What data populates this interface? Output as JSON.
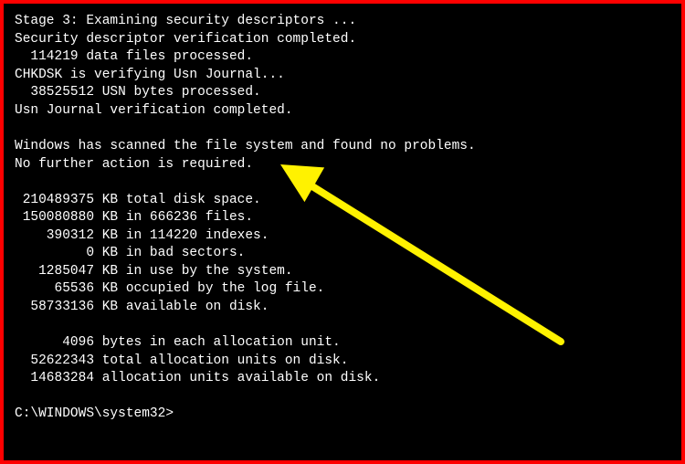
{
  "lines": [
    "Stage 3: Examining security descriptors ...",
    "Security descriptor verification completed.",
    "  114219 data files processed.",
    "CHKDSK is verifying Usn Journal...",
    "  38525512 USN bytes processed.",
    "Usn Journal verification completed.",
    "",
    "Windows has scanned the file system and found no problems.",
    "No further action is required.",
    "",
    " 210489375 KB total disk space.",
    " 150080880 KB in 666236 files.",
    "    390312 KB in 114220 indexes.",
    "         0 KB in bad sectors.",
    "   1285047 KB in use by the system.",
    "     65536 KB occupied by the log file.",
    "  58733136 KB available on disk.",
    "",
    "      4096 bytes in each allocation unit.",
    "  52622343 total allocation units on disk.",
    "  14683284 allocation units available on disk.",
    "",
    "C:\\WINDOWS\\system32>"
  ],
  "annotation": {
    "color": "#fff200",
    "description": "arrow-icon"
  }
}
